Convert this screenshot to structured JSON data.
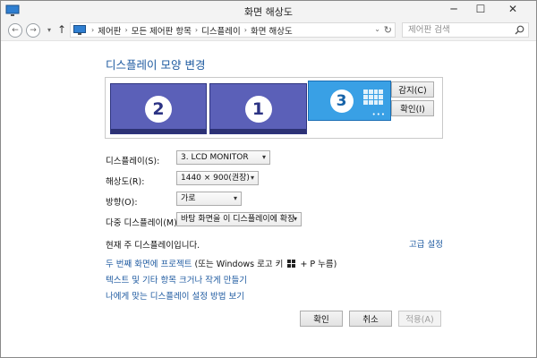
{
  "window": {
    "title": "화면 해상도",
    "minimize": "─",
    "maximize": "☐",
    "close": "✕"
  },
  "nav": {
    "back": "←",
    "forward": "→",
    "recent": "▾",
    "up": "↑",
    "breadcrumbs": [
      "제어판",
      "모든 제어판 항목",
      "디스플레이",
      "화면 해상도"
    ],
    "breadcrumb_separator": "›",
    "address_dropdown": "⌄",
    "refresh": "↻",
    "search_placeholder": "제어판 검색"
  },
  "main": {
    "heading": "디스플레이 모양 변경",
    "monitors": [
      {
        "number": "2",
        "selected": false
      },
      {
        "number": "1",
        "selected": false
      },
      {
        "number": "3",
        "selected": true,
        "dots": "•••"
      }
    ],
    "detect_button": "감지(C)",
    "identify_button": "확인(I)",
    "fields": {
      "display": {
        "label": "디스플레이(S):",
        "value": "3. LCD MONITOR"
      },
      "resolution": {
        "label": "해상도(R):",
        "value": "1440 × 900(권장)"
      },
      "orientation": {
        "label": "방향(O):",
        "value": "가로"
      },
      "multiple_displays": {
        "label": "다중 디스플레이(M):",
        "value": "바탕 화면을 이 디스플레이에 확장"
      }
    },
    "dropdown_arrow": "▾",
    "main_display_text": "현재 주 디스플레이입니다.",
    "advanced_settings_link": "고급 설정",
    "links": {
      "project_link": "두 번째 화면에 프로젝트",
      "project_suffix_prefix": "(또는 Windows 로고 키",
      "project_suffix_end": "+ P 누름)",
      "text_size": "텍스트 및 기타 항목 크거나 작게 만들기",
      "which_settings": "나에게 맞는 디스플레이 설정 방법 보기"
    },
    "buttons": {
      "ok": "확인",
      "cancel": "취소",
      "apply": "적용(A)"
    }
  },
  "colors": {
    "accent_blue": "#1e5aa0",
    "monitor_fill": "#5b60b8",
    "selected_monitor_fill": "#39a0e5"
  }
}
